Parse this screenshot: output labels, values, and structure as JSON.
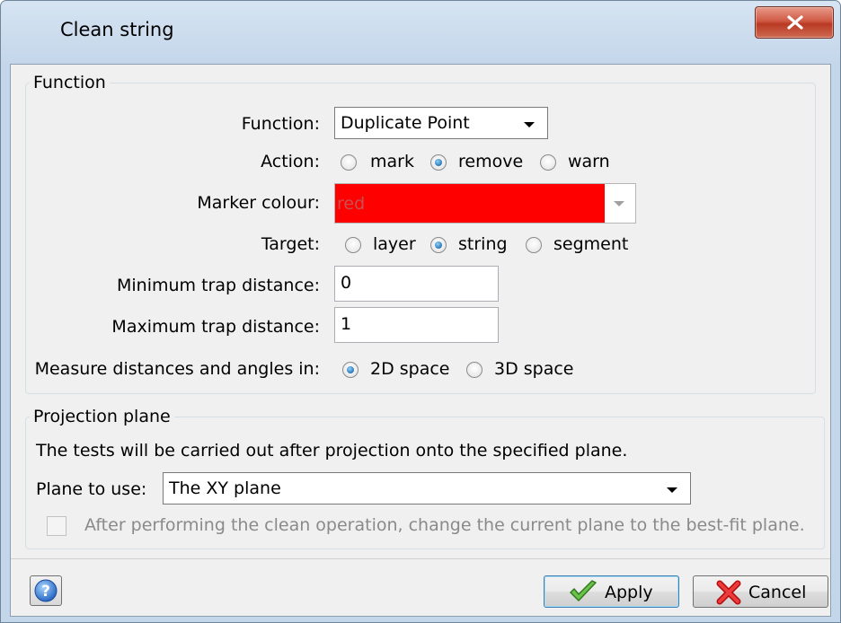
{
  "window": {
    "title": "Clean string"
  },
  "function_group": {
    "label": "Function",
    "function": {
      "label": "Function:",
      "value": "Duplicate Point"
    },
    "action": {
      "label": "Action:",
      "options": [
        "mark",
        "remove",
        "warn"
      ],
      "selected": "remove"
    },
    "marker_colour": {
      "label": "Marker colour:",
      "value": "red",
      "color": "#ff0000"
    },
    "target": {
      "label": "Target:",
      "options": [
        "layer",
        "string",
        "segment"
      ],
      "selected": "string"
    },
    "min_trap": {
      "label": "Minimum trap distance:",
      "value": "0"
    },
    "max_trap": {
      "label": "Maximum trap distance:",
      "value": "1"
    },
    "measure": {
      "label": "Measure distances and angles in:",
      "options": [
        "2D space",
        "3D space"
      ],
      "selected": "2D space"
    }
  },
  "projection_group": {
    "label": "Projection plane",
    "description": "The tests will be carried out after projection onto the specified plane.",
    "plane": {
      "label": "Plane to use:",
      "value": "The XY plane"
    },
    "best_fit": {
      "label": "After performing the clean operation, change the current plane to the best-fit plane.",
      "checked": false,
      "disabled": true
    }
  },
  "buttons": {
    "apply": "Apply",
    "cancel": "Cancel"
  },
  "icons": {
    "close": "close-icon",
    "help": "help-icon",
    "apply": "checkmark-icon",
    "cancel": "red-x-icon"
  }
}
